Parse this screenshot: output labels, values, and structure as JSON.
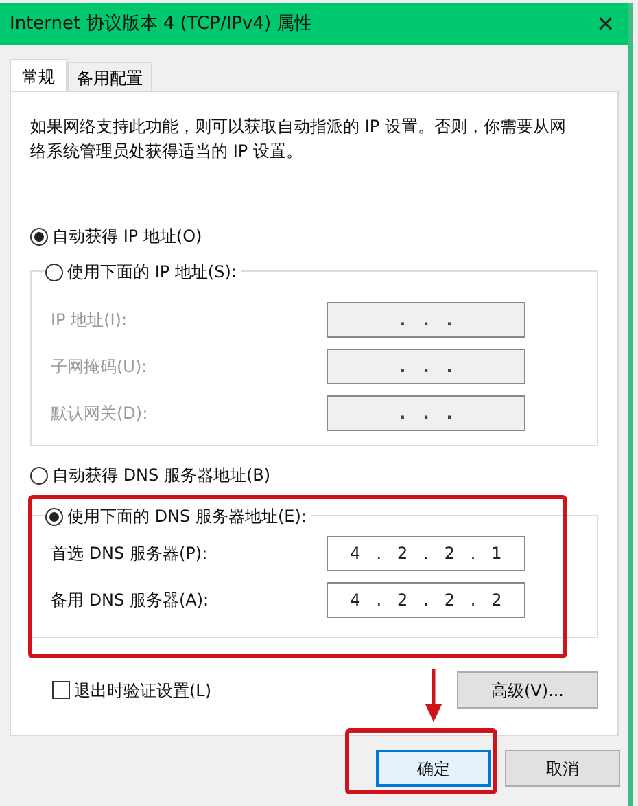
{
  "window": {
    "title": "Internet 协议版本 4 (TCP/IPv4) 属性",
    "close": "✕"
  },
  "tabs": [
    {
      "label": "常规",
      "selected": true
    },
    {
      "label": "备用配置",
      "selected": false
    }
  ],
  "description": "如果网络支持此功能，则可以获取自动指派的 IP 设置。否则，你需要从网络系统管理员处获得适当的 IP 设置。",
  "ip_mode": [
    {
      "label": "自动获得 IP 地址(O)",
      "selected": true
    },
    {
      "label": "使用下面的 IP 地址(S):",
      "selected": false
    }
  ],
  "ip_fields": [
    {
      "label": "IP 地址(I):",
      "value": ". . .",
      "disabled": true
    },
    {
      "label": "子网掩码(U):",
      "value": ". . .",
      "disabled": true
    },
    {
      "label": "默认网关(D):",
      "value": ". . .",
      "disabled": true
    }
  ],
  "dns_mode": [
    {
      "label": "自动获得 DNS 服务器地址(B)",
      "selected": false
    },
    {
      "label": "使用下面的 DNS 服务器地址(E):",
      "selected": true
    }
  ],
  "dns_fields": [
    {
      "label": "首选 DNS 服务器(P):",
      "value": "4 . 2 . 2 . 1",
      "disabled": false
    },
    {
      "label": "备用 DNS 服务器(A):",
      "value": "4 . 2 . 2 . 2",
      "disabled": false
    }
  ],
  "validate": {
    "label": "退出时验证设置(L)",
    "checked": false
  },
  "advanced_button": "高级(V)...",
  "buttons": [
    "确定",
    "取消"
  ]
}
